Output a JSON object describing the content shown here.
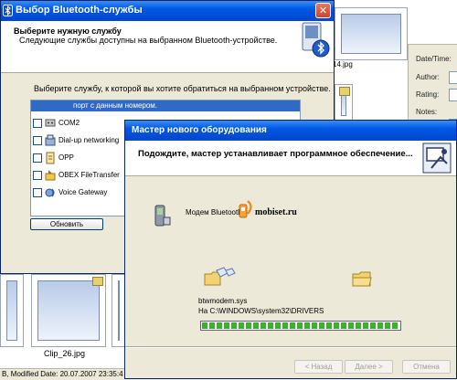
{
  "background": {
    "thumbnail_filename": "14.jpg",
    "clip_filename": "Clip_26.jpg",
    "status_text": "B, Modified Date: 20.07.2007 23:35:4",
    "meta_labels": [
      "Date/Time:",
      "Author:",
      "Rating:",
      "Notes:"
    ]
  },
  "bt_dialog": {
    "title": "Выбор Bluetooth-службы",
    "heading": "Выберите нужную службу",
    "subheading": "Следующие службы доступны на выбранном Bluetooth-устройстве.",
    "prompt": "Выберите службу, к которой вы хотите обратиться на выбранном устройстве.",
    "selected_text": "порт с данным номером.",
    "services": [
      {
        "label": "COM2",
        "icon": "serial-port-icon"
      },
      {
        "label": "Dial-up networking",
        "icon": "dialup-icon"
      },
      {
        "label": "OPP",
        "icon": "object-push-icon"
      },
      {
        "label": "OBEX FileTransfer",
        "icon": "file-transfer-icon"
      },
      {
        "label": "Voice Gateway",
        "icon": "voice-gateway-icon"
      }
    ],
    "refresh_label": "Обновить",
    "close_glyph": "✕"
  },
  "wizard": {
    "title": "Мастер нового оборудования",
    "heading": "Подождите, мастер устанавливает программное обеспечение...",
    "device_name": "Модем Bluetooth",
    "watermark": "mobiset.ru",
    "file_name": "btwmodem.sys",
    "destination": "На C:\\WINDOWS\\system32\\DRIVERS",
    "progress_percent": 100,
    "buttons": {
      "back": "< Назад",
      "next": "Далее >",
      "cancel": "Отмена"
    }
  },
  "colors": {
    "title_bar": "#0058e6",
    "selection": "#316ac5",
    "progress": "#37b02b"
  }
}
